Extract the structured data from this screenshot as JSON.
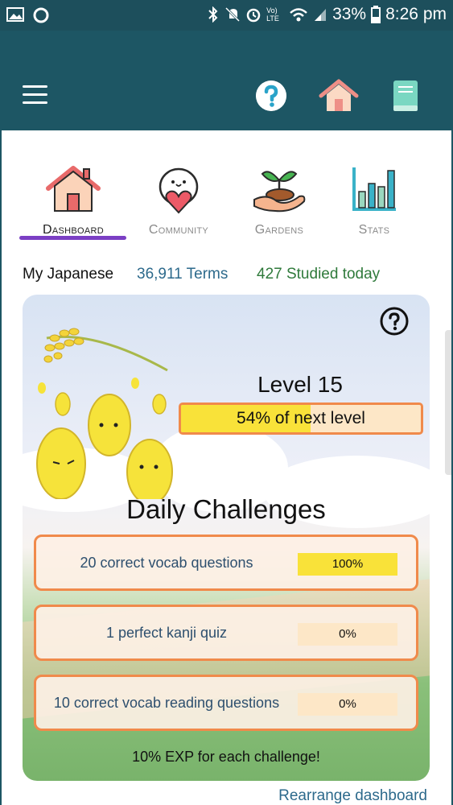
{
  "status_bar": {
    "battery_percent": "33%",
    "time": "8:26 pm",
    "network_label": "Vo) LTE"
  },
  "appbar": {
    "icons": [
      "menu-icon",
      "help-icon",
      "home-icon",
      "book-icon"
    ]
  },
  "tabs": [
    {
      "label": "Dashboard",
      "icon": "house-icon",
      "active": true
    },
    {
      "label": "Community",
      "icon": "mascot-heart-icon",
      "active": false
    },
    {
      "label": "Gardens",
      "icon": "sprout-hand-icon",
      "active": false
    },
    {
      "label": "Stats",
      "icon": "bar-chart-icon",
      "active": false
    }
  ],
  "summary": {
    "language": "My Japanese",
    "terms": "36,911 Terms",
    "studied": "427 Studied today"
  },
  "level": {
    "title": "Level 15",
    "progress_text": "54% of next level",
    "progress": 0.54
  },
  "daily": {
    "title": "Daily Challenges",
    "challenges": [
      {
        "label": "20 correct vocab questions",
        "percent_text": "100%",
        "progress": 1.0
      },
      {
        "label": "1 perfect kanji quiz",
        "percent_text": "0%",
        "progress": 0.0
      },
      {
        "label": "10 correct vocab reading questions",
        "percent_text": "0%",
        "progress": 0.0
      }
    ],
    "exp_note": "10% EXP for each challenge!"
  },
  "footer": {
    "rearrange": "Rearrange dashboard"
  },
  "colors": {
    "header": "#1d5664",
    "accent_underline": "#7b3fc4",
    "bar_fill": "#f9e239",
    "bar_border": "#f08a4b",
    "link": "#2d6a8c",
    "studied": "#2f7a3b"
  }
}
